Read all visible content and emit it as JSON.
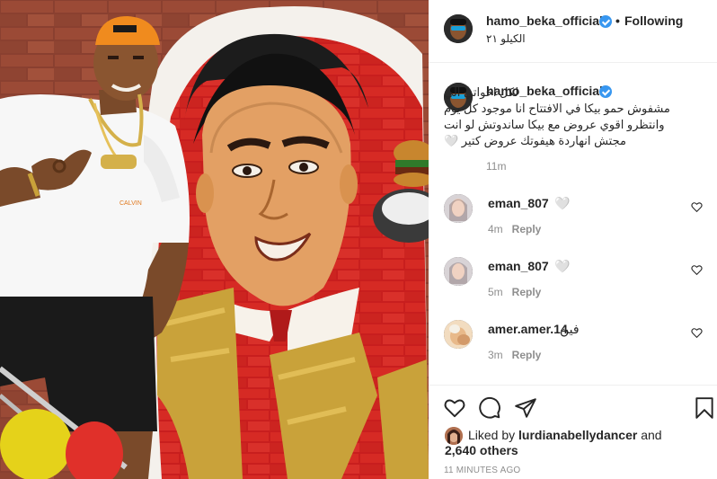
{
  "post": {
    "username": "hamo_beka_official",
    "follow_status": "Following",
    "location": "الكيلو ٢١"
  },
  "caption": {
    "username": "hamo_beka_official",
    "lines": [
      "لكل اخواتي الي",
      "مشفوش حمو بيكا في الافتتاح انا موجود كل يوم",
      "وانتظرو اقوي عروض مع بيكا ساندوتش لو انت",
      "مجتش انهاردة هيفوتك عروض كتير 🤍"
    ],
    "time": "11m"
  },
  "comments": [
    {
      "username": "eman_807",
      "text": "🤍",
      "time": "4m",
      "reply_label": "Reply"
    },
    {
      "username": "eman_807",
      "text": "🤍",
      "time": "5m",
      "reply_label": "Reply"
    },
    {
      "username": "amer.amer.14",
      "text": "فين",
      "time": "3m",
      "reply_label": "Reply"
    }
  ],
  "likes": {
    "prefix": "Liked by",
    "user": "lurdianabellydancer",
    "joiner": "and",
    "others": "2,640 others"
  },
  "timestamp": "11 MINUTES AGO",
  "icons": {
    "verified": "verified-badge-icon",
    "like": "heart-icon",
    "comment": "comment-bubble-icon",
    "share": "paper-plane-icon",
    "save": "bookmark-icon"
  },
  "colors": {
    "verified": "#3897f0",
    "secondary_text": "#8e8e8e",
    "primary_text": "#262626"
  }
}
